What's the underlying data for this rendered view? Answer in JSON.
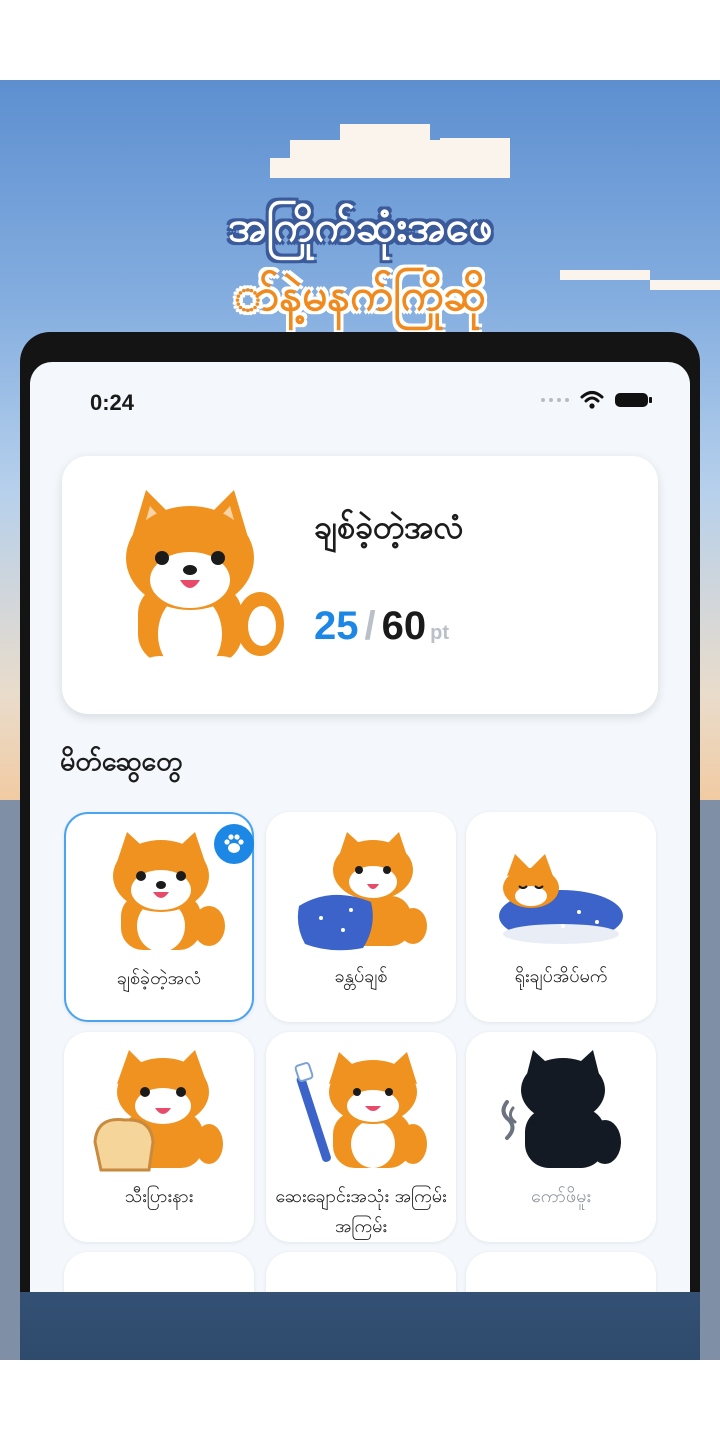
{
  "headline": {
    "line1": "အကြိုက်ဆုံးအဖေ",
    "line2": "ာ်နဲ့မနက်ကြိုဆို"
  },
  "status_bar": {
    "time": "0:24",
    "icons": [
      "signal-dots-icon",
      "wifi-icon",
      "battery-icon"
    ]
  },
  "current_pet": {
    "name": "ချစ်ခဲ့တဲ့အလံ",
    "points_current": "25",
    "separator": "/",
    "points_total": "60",
    "unit": "pt"
  },
  "section": {
    "title": "မိတ်ဆွေတွေ"
  },
  "friends": [
    {
      "label": "ချစ်ခဲ့တဲ့အလံ",
      "selected": true,
      "locked": false
    },
    {
      "label": "ခန္တပ်ချစ်",
      "selected": false,
      "locked": false
    },
    {
      "label": "ရိုးချပ်အိပ်မက်",
      "selected": false,
      "locked": false
    },
    {
      "label": "သီးပြားနား",
      "selected": false,
      "locked": false
    },
    {
      "label": "ဆေးချောင်းအသုံး အကြမ်းအကြမ်း",
      "selected": false,
      "locked": false
    },
    {
      "label": "ကော်ဖိမူး",
      "selected": false,
      "locked": true
    }
  ],
  "colors": {
    "accent": "#1d87e6",
    "dog_orange": "#f0921f",
    "headline_orange": "#f08a1e"
  }
}
